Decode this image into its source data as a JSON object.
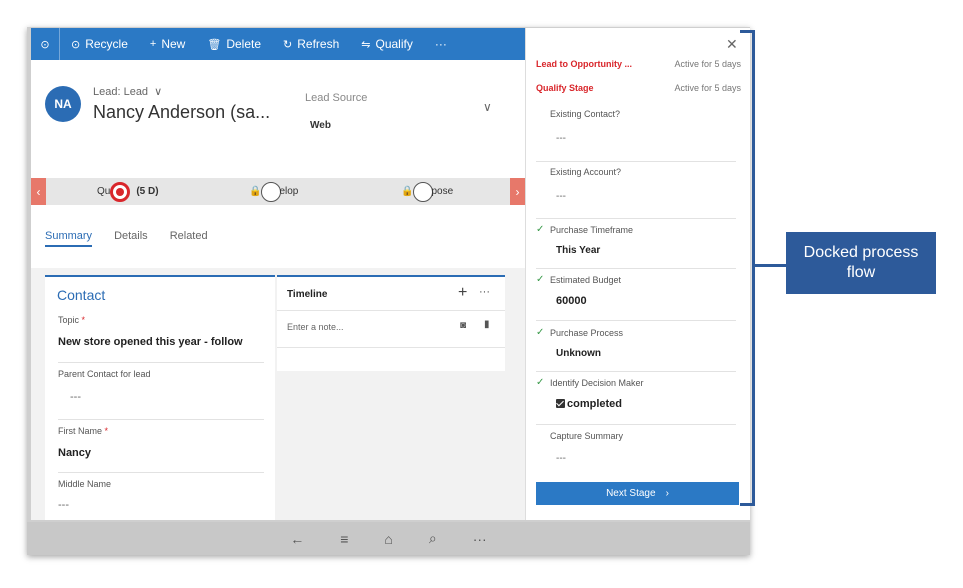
{
  "command_bar": {
    "items": [
      {
        "label": "Recycle",
        "icon": "recycle-icon"
      },
      {
        "label": "New",
        "icon": "plus-icon"
      },
      {
        "label": "Delete",
        "icon": "trash-icon"
      },
      {
        "label": "Refresh",
        "icon": "refresh-icon"
      },
      {
        "label": "Qualify",
        "icon": "qualify-icon"
      }
    ],
    "more": "···"
  },
  "header": {
    "avatar_initials": "NA",
    "entity_type": "Lead: Lead",
    "name": "Nancy Anderson (sa...",
    "field_label": "Lead Source",
    "field_value": "Web"
  },
  "process_bar": {
    "stages": [
      {
        "label": "Qu",
        "duration": "(5 D)",
        "active": true
      },
      {
        "label": "elop",
        "active": false
      },
      {
        "label": "pose",
        "active": false
      }
    ]
  },
  "tabs": [
    {
      "label": "Summary",
      "active": true
    },
    {
      "label": "Details",
      "active": false
    },
    {
      "label": "Related",
      "active": false
    }
  ],
  "contact": {
    "title": "Contact",
    "fields": [
      {
        "label": "Topic",
        "required": true,
        "value": "New store opened this year - follow"
      },
      {
        "label": "Parent Contact for lead",
        "required": false,
        "value": "---"
      },
      {
        "label": "First Name",
        "required": true,
        "value": "Nancy"
      },
      {
        "label": "Middle Name",
        "required": false,
        "value": "---"
      }
    ]
  },
  "timeline": {
    "title": "Timeline",
    "placeholder": "Enter a note..."
  },
  "flyout": {
    "process_name": "Lead to Opportunity ...",
    "process_status": "Active for 5 days",
    "stage_name": "Qualify Stage",
    "stage_status": "Active for 5 days",
    "steps": [
      {
        "label": "Existing Contact?",
        "value": "---",
        "done": false
      },
      {
        "label": "Existing Account?",
        "value": "---",
        "done": false
      },
      {
        "label": "Purchase Timeframe",
        "value": "This Year",
        "done": true
      },
      {
        "label": "Estimated Budget",
        "value": "60000",
        "done": true
      },
      {
        "label": "Purchase Process",
        "value": "Unknown",
        "done": true
      },
      {
        "label": "Identify Decision Maker",
        "value": "completed",
        "done": true
      },
      {
        "label": "Capture Summary",
        "value": "---",
        "done": false
      }
    ],
    "next_stage": "Next Stage"
  },
  "callout": {
    "text": "Docked process flow"
  }
}
